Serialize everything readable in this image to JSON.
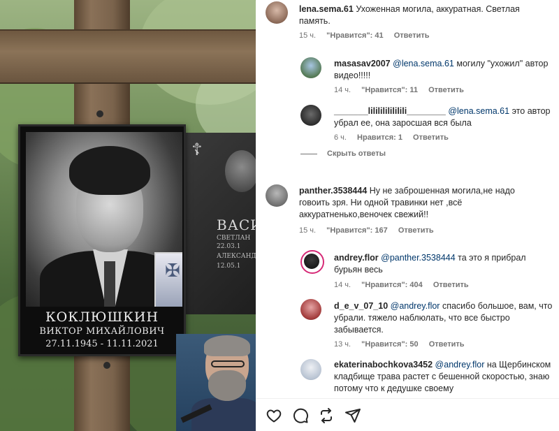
{
  "photo": {
    "plaque": {
      "surname": "КОКЛЮШКИН",
      "given_names": "ВИКТОР МИХАЙЛОВИЧ",
      "dates": "27.11.1945 - 11.11.2021"
    },
    "background_stone": {
      "name": "ВАСИ",
      "line1": "СВЕТЛАН",
      "line2": "22.03.1",
      "line3": "АЛЕКСАНД",
      "line4": "12.05.1"
    }
  },
  "comments": [
    {
      "user": "lena.sema.61",
      "text": "Ухоженная могила, аккуратная. Светлая память.",
      "time": "15 ч.",
      "likes": "\"Нравится\": 41",
      "reply_label": "Ответить",
      "replies": [
        {
          "user": "masasav2007",
          "mention": "@lena.sema.61",
          "text": "могилу \"ухожил\" автор видео!!!!!",
          "time": "14 ч.",
          "likes": "\"Нравится\": 11",
          "reply_label": "Ответить"
        },
        {
          "user": "_______lililililililili________",
          "mention": "@lena.sema.61",
          "text": "это автор убрал ее, она заросшая вся была",
          "time": "6 ч.",
          "likes": "Нравится: 1",
          "reply_label": "Ответить"
        }
      ],
      "hide_replies": "Скрыть ответы"
    },
    {
      "user": "panther.3538444",
      "text": "Ну не заброшенная могила,не надо говоить зря. Ни одной травинки нет ,всё аккуратненько,веночек свежий!!",
      "time": "15 ч.",
      "likes": "\"Нравится\": 167",
      "reply_label": "Ответить",
      "replies": [
        {
          "user": "andrey.flor",
          "mention": "@panther.3538444",
          "text": "та это я прибрал бурьян весь",
          "time": "14 ч.",
          "likes": "\"Нравится\": 404",
          "reply_label": "Ответить"
        },
        {
          "user": "d_e_v_07_10",
          "mention": "@andrey.flor",
          "text": "спасибо большое, вам, что убрали. тяжело наблюлать, что все быстро забывается.",
          "time": "13 ч.",
          "likes": "\"Нравится\": 50",
          "reply_label": "Ответить"
        },
        {
          "user": "ekaterinabochkova3452",
          "mention": "@andrey.flor",
          "text": "на Щербинском кладбище трава растет с бешенной скоростью, знаю потому что к дедушке своему",
          "time": "",
          "likes": "",
          "reply_label": ""
        }
      ]
    }
  ],
  "actions": {
    "like": "heart-icon",
    "comment": "comment-icon",
    "repost": "repost-icon",
    "share": "send-icon"
  }
}
